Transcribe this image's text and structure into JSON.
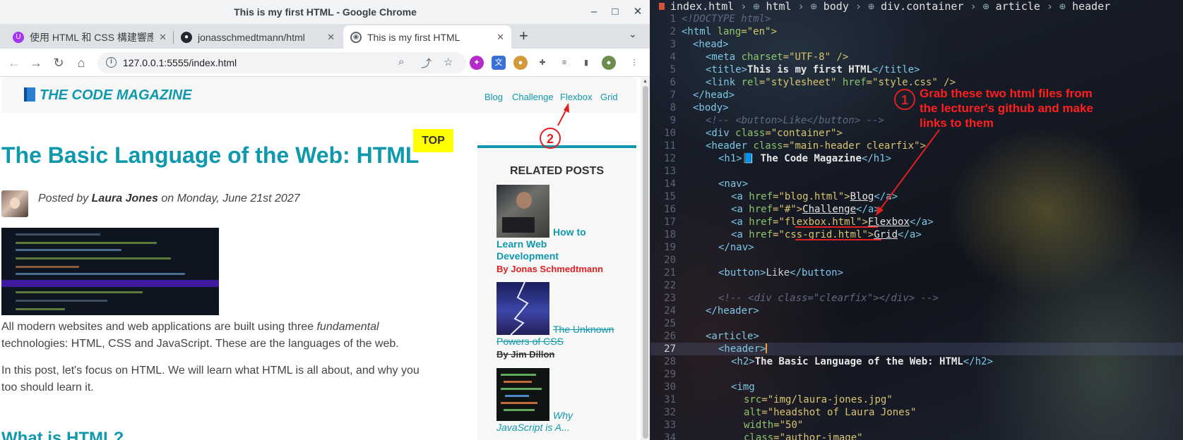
{
  "browser": {
    "window_title": "This is my first HTML - Google Chrome",
    "tabs": [
      {
        "label": "使用 HTML 和 CSS 構建響應式",
        "icon": "udemy-icon",
        "active": false
      },
      {
        "label": "jonasschmedtmann/html",
        "icon": "github-icon",
        "active": false
      },
      {
        "label": "This is my first HTML",
        "icon": "broadcast-icon",
        "active": true
      }
    ],
    "url": "127.0.0.1:5555/index.html"
  },
  "page": {
    "logo_text": "The Code Magazine",
    "nav": [
      "Blog",
      "Challenge",
      "Flexbox",
      "Grid"
    ],
    "like_button": "TOP",
    "article": {
      "title": "The Basic Language of the Web: HTML",
      "posted_by_prefix": "Posted by ",
      "author": "Laura Jones",
      "date_text": " on Monday, June 21st 2027",
      "p1_start": "All modern websites and web applications are built using three ",
      "p1_em": "fundamental",
      "p1_line2": "technologies: HTML, CSS and JavaScript. These are the languages of the web.",
      "p2_line1": "In this post, let's focus on HTML. We will learn what HTML is all about, and why you",
      "p2_line2": "too should learn it.",
      "subheading": "What is HTML?"
    },
    "aside": {
      "heading": "Related Posts",
      "posts": [
        {
          "title_line1": "How to",
          "title_line2": "Learn Web",
          "title_line3": "Development",
          "author": "By Jonas Schmedtmann"
        },
        {
          "title_line1": "The Unknown",
          "title_line2": "Powers of CSS",
          "author": "By Jim Dillon"
        },
        {
          "title_line1": "Why",
          "title_line2": "JavaScript is A..."
        }
      ]
    }
  },
  "editor": {
    "breadcrumbs": [
      "index.html",
      "html",
      "body",
      "div.container",
      "article",
      "header"
    ],
    "line_numbers": [
      "1",
      "2",
      "3",
      "4",
      "5",
      "6",
      "7",
      "8",
      "9",
      "10",
      "11",
      "12",
      "13",
      "14",
      "15",
      "16",
      "17",
      "18",
      "19",
      "20",
      "21",
      "22",
      "23",
      "24",
      "25",
      "26",
      "27",
      "28",
      "29",
      "30",
      "31",
      "32",
      "33",
      "34"
    ],
    "current_line": "27",
    "code": {
      "l1": "<!DOCTYPE html>",
      "l2_a": "<html ",
      "l2_b": "lang",
      "l2_c": "=\"en\">",
      "l3": "<head>",
      "l4_a": "<meta ",
      "l4_b": "charset",
      "l4_c": "=\"UTF-8\" />",
      "l5_a": "<title>",
      "l5_b": "This is my first HTML",
      "l5_c": "</title>",
      "l6_a": "<link ",
      "l6_b": "rel",
      "l6_c": "=\"stylesheet\" ",
      "l6_d": "href",
      "l6_e": "=\"style.css\" />",
      "l7": "</head>",
      "l8": "<body>",
      "l9": "<!-- <button>Like</button> -->",
      "l10_a": "<div ",
      "l10_b": "class",
      "l10_c": "=\"container\">",
      "l11_a": "<header ",
      "l11_b": "class",
      "l11_c": "=\"main-header clearfix\">",
      "l12_a": "<h1>",
      "l12_b": "📘 The Code Magazine",
      "l12_c": "</h1>",
      "l14": "<nav>",
      "l15_a": "<a ",
      "l15_b": "href",
      "l15_c": "=\"blog.html\">",
      "l15_d": "Blog",
      "l15_e": "</a>",
      "l16_a": "<a ",
      "l16_b": "href",
      "l16_c": "=\"#\">",
      "l16_d": "Challenge",
      "l16_e": "</a>",
      "l17_a": "<a ",
      "l17_b": "href",
      "l17_c": "=\"flexbox.html\">",
      "l17_d": "Flexbox",
      "l17_e": "</a>",
      "l18_a": "<a ",
      "l18_b": "href",
      "l18_c": "=\"css-grid.html\">",
      "l18_d": "Grid",
      "l18_e": "</a>",
      "l19": "</nav>",
      "l21_a": "<button>",
      "l21_b": "Like",
      "l21_c": "</button>",
      "l23": "<!-- <div class=\"clearfix\"></div> -->",
      "l24": "</header>",
      "l26": "<article>",
      "l27": "<header>",
      "l28_a": "<h2>",
      "l28_b": "The Basic Language of the Web: HTML",
      "l28_c": "</h2>",
      "l30": "<img",
      "l31_a": "src",
      "l31_b": "=\"img/laura-jones.jpg\"",
      "l32_a": "alt",
      "l32_b": "=\"headshot of Laura Jones\"",
      "l33_a": "width",
      "l33_b": "=\"50\"",
      "l34_a": "class",
      "l34_b": "=\"author-image\""
    }
  },
  "annotations": {
    "note_line1": "Grab these two html files from",
    "note_line2": "the lecturer's github and make",
    "note_line3": "links to them",
    "num1": "1",
    "num2": "2",
    "color": "#e02020"
  }
}
